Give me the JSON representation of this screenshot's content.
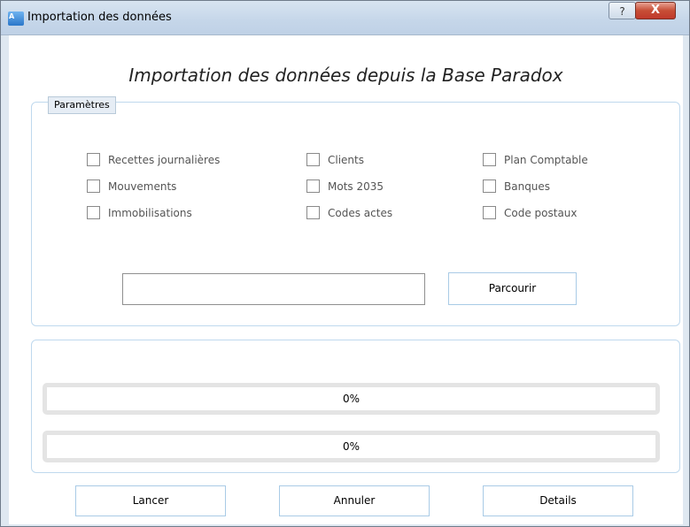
{
  "window": {
    "title": "Importation des données",
    "icon": "app-icon",
    "help_label": "?",
    "close_label": "X"
  },
  "heading": "Importation des données depuis la Base Paradox",
  "params": {
    "legend": "Paramètres",
    "checkboxes": [
      {
        "label": "Recettes journalières",
        "checked": false
      },
      {
        "label": "Mouvements",
        "checked": false
      },
      {
        "label": "Immobilisations",
        "checked": false
      },
      {
        "label": "Clients",
        "checked": false
      },
      {
        "label": "Mots 2035",
        "checked": false
      },
      {
        "label": "Codes actes",
        "checked": false
      },
      {
        "label": "Plan Comptable",
        "checked": false
      },
      {
        "label": "Banques",
        "checked": false
      },
      {
        "label": "Code postaux",
        "checked": false
      }
    ],
    "path_value": "",
    "browse_label": "Parcourir"
  },
  "progress": [
    {
      "label": "0%",
      "value": 0
    },
    {
      "label": "0%",
      "value": 0
    }
  ],
  "buttons": {
    "start": "Lancer",
    "cancel": "Annuler",
    "details": "Details"
  }
}
